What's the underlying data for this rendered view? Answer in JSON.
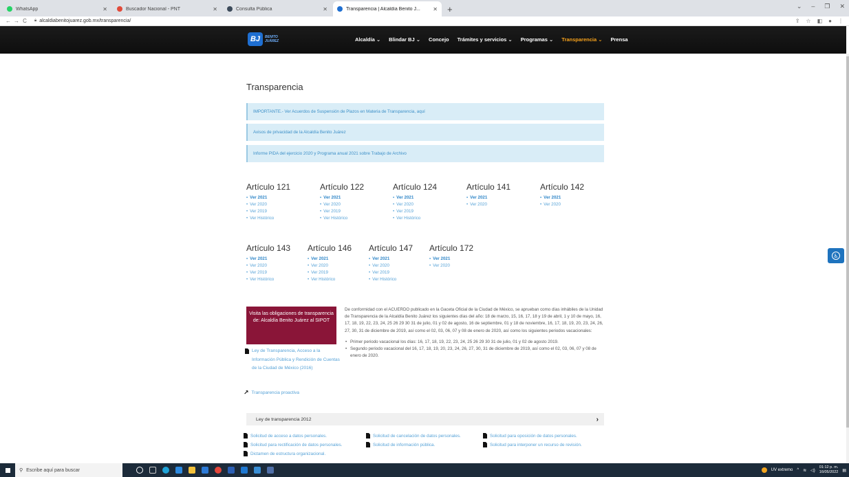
{
  "browser": {
    "tabs": [
      {
        "label": "WhatsApp",
        "color": "#25d366",
        "active": false
      },
      {
        "label": "Buscador Nacional - PNT",
        "color": "#e14b3b",
        "active": false
      },
      {
        "label": "Consulta Pública",
        "color": "#3c4a5a",
        "active": false
      },
      {
        "label": "Transparencia | Alcaldía Benito J...",
        "color": "#1f6fd1",
        "active": true
      }
    ],
    "url": "alcaldiabenitojuarez.gob.mx/transparencia/"
  },
  "header": {
    "logo_mark": "BJ",
    "logo_text_1": "BENITO",
    "logo_text_2": "JUÁREZ",
    "nav": [
      {
        "label": "Alcaldía ⌄",
        "active": false
      },
      {
        "label": "Blindar BJ ⌄",
        "active": false
      },
      {
        "label": "Concejo",
        "active": false
      },
      {
        "label": "Trámites y servicios ⌄",
        "active": false
      },
      {
        "label": "Programas ⌄",
        "active": false
      },
      {
        "label": "Transparencia ⌄",
        "active": true
      },
      {
        "label": "Prensa",
        "active": false
      }
    ]
  },
  "main": {
    "title": "Transparencia",
    "notices": [
      "IMPORTANTE.- Ver Acuerdos de Suspensión de Plazos en Materia de Transparencia, aquí",
      "Avisos de privacidad de la Alcaldía Benito Juárez",
      "Informe PIDA del ejercicio 2020 y Programa anual 2021 sobre Trabajo de Archivo"
    ],
    "articles": [
      {
        "title": "Artículo 121",
        "links": [
          "Ver 2021",
          "Ver 2020",
          "Ver 2019",
          "Ver Histórico"
        ]
      },
      {
        "title": "Artículo 122",
        "links": [
          "Ver 2021",
          "Ver 2020",
          "Ver 2019",
          "Ver Histórico"
        ]
      },
      {
        "title": "Artículo 124",
        "links": [
          "Ver 2021",
          "Ver 2020",
          "Ver 2019",
          "Ver Histórico"
        ]
      },
      {
        "title": "Artículo 141",
        "links": [
          "Ver 2021",
          "Ver 2020"
        ]
      },
      {
        "title": "Artículo 142",
        "links": [
          "Ver 2021",
          "Ver 2020"
        ]
      },
      {
        "title": "Artículo 143",
        "links": [
          "Ver 2021",
          "Ver 2020",
          "Ver 2019",
          "Ver Histórico"
        ]
      },
      {
        "title": "Artículo 146",
        "links": [
          "Ver 2021",
          "Ver 2020",
          "Ver 2019",
          "Ver Histórico"
        ]
      },
      {
        "title": "Artículo 147",
        "links": [
          "Ver 2021",
          "Ver 2020",
          "Ver 2019",
          "Ver Histórico"
        ]
      },
      {
        "title": "Artículo 172",
        "links": [
          "Ver 2021",
          "Ver 2020"
        ]
      }
    ],
    "sipot_button": "Visita las obligaciones de transparencia de: Alcaldía Benito Juárez al SIPOT",
    "ley_link": "Ley de Transparencia, Acceso a la Información Pública y Rendición de Cuentas de la Ciudad de México (2016)",
    "proactiva_link": "Transparencia proactiva",
    "acuerdo_text": "De conformidad con el ACUERDO publicado en la Gaceta Oficial de la Ciudad de México, se aprueban como días inhábiles de la Unidad de Transparencia de la Alcaldía Benito Juárez los siguientes días del año: 18 de marzo, 15, 16, 17, 18 y 19 de abril, 1 y 10 de mayo, 16, 17, 18, 19, 22, 23, 24, 25 26 29 30 31 de julio, 01 y 02 de agosto, 16 de septiembre, 01 y 18 de noviembre, 16, 17, 18, 19, 20, 23, 24, 26, 27, 30, 31 de diciembre de 2019, así como el 02, 03, 06, 07 y 08 de enero de 2020, así como los siguientes periodos vacacionales:",
    "vacaciones": [
      "Primer periodo vacacional los días: 16, 17, 18, 19, 22, 23, 24, 25 26 29 30 31 de julio, 01 y 02 de agosto 2019.",
      "Segundo periodo vacacional del 16, 17, 18, 19, 20, 23, 24, 26, 27, 30, 31 de diciembre de 2019, así como el 02, 03, 06, 07 y 08 de enero de 2020."
    ],
    "ley2012": "Ley de transparencia 2012",
    "solicitudes": [
      "Solicitud de acceso a datos personales.",
      "Solicitud de cancelación de datos personales.",
      "Solicitud para oposición de datos personales.",
      "Solicitud para rectificación de datos personales.",
      "Solicitud de información pública.",
      "Solicitud para interponer un recurso de revisión.",
      "Dictamen de estructura organizacional."
    ]
  },
  "taskbar": {
    "search_placeholder": "Escribe aquí para buscar",
    "weather": "UV extremo",
    "time": "01:12 p. m.",
    "date": "16/05/2022"
  }
}
